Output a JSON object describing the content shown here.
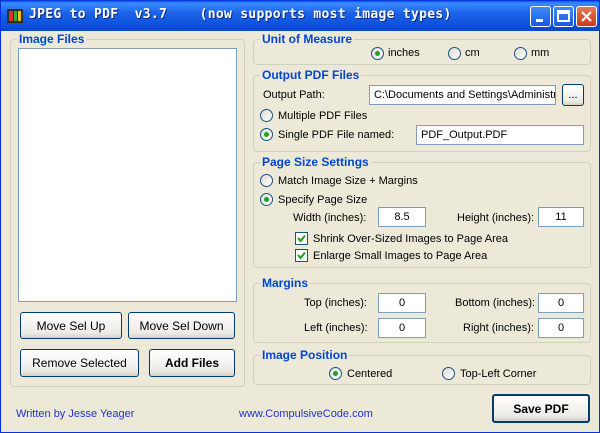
{
  "window": {
    "title": "JPEG to PDF  v3.7    (now supports most image types)",
    "icon": "app-icon",
    "title_buttons": [
      "minimize-icon",
      "maximize-icon",
      "close-icon"
    ]
  },
  "image_files": {
    "title": "Image Files",
    "items": [],
    "buttons": {
      "move_up": "Move Sel Up",
      "move_down": "Move Sel Down",
      "remove": "Remove Selected",
      "add": "Add Files"
    }
  },
  "unit_of_measure": {
    "title": "Unit of Measure",
    "options": [
      "inches",
      "cm",
      "mm"
    ],
    "selected": "inches"
  },
  "output_pdf": {
    "title": "Output PDF Files",
    "path_label": "Output Path:",
    "path_value": "C:\\Documents and Settings\\Administrat",
    "browse_label": "...",
    "multiple_label": "Multiple PDF Files",
    "single_label": "Single PDF File named:",
    "selected": "single",
    "filename": "PDF_Output.PDF"
  },
  "page_size": {
    "title": "Page Size Settings",
    "match_label": "Match Image Size + Margins",
    "specify_label": "Specify Page Size",
    "selected": "specify",
    "width_label": "Width (inches):",
    "width_value": "8.5",
    "height_label": "Height (inches):",
    "height_value": "11",
    "shrink_label": "Shrink Over-Sized Images to Page Area",
    "shrink_checked": true,
    "enlarge_label": "Enlarge Small Images to Page Area",
    "enlarge_checked": true
  },
  "margins": {
    "title": "Margins",
    "top_label": "Top (inches):",
    "top_value": "0",
    "bottom_label": "Bottom (inches):",
    "bottom_value": "0",
    "left_label": "Left (inches):",
    "left_value": "0",
    "right_label": "Right (inches):",
    "right_value": "0"
  },
  "image_position": {
    "title": "Image Position",
    "centered_label": "Centered",
    "topleft_label": "Top-Left Corner",
    "selected": "centered"
  },
  "footer": {
    "author": "Written by Jesse Yeager",
    "website": "www.CompulsiveCode.com",
    "save_label": "Save PDF"
  },
  "colors": {
    "group_title": "#0046d5",
    "link": "#2233cc",
    "titlebar": "#0b4fd9"
  }
}
